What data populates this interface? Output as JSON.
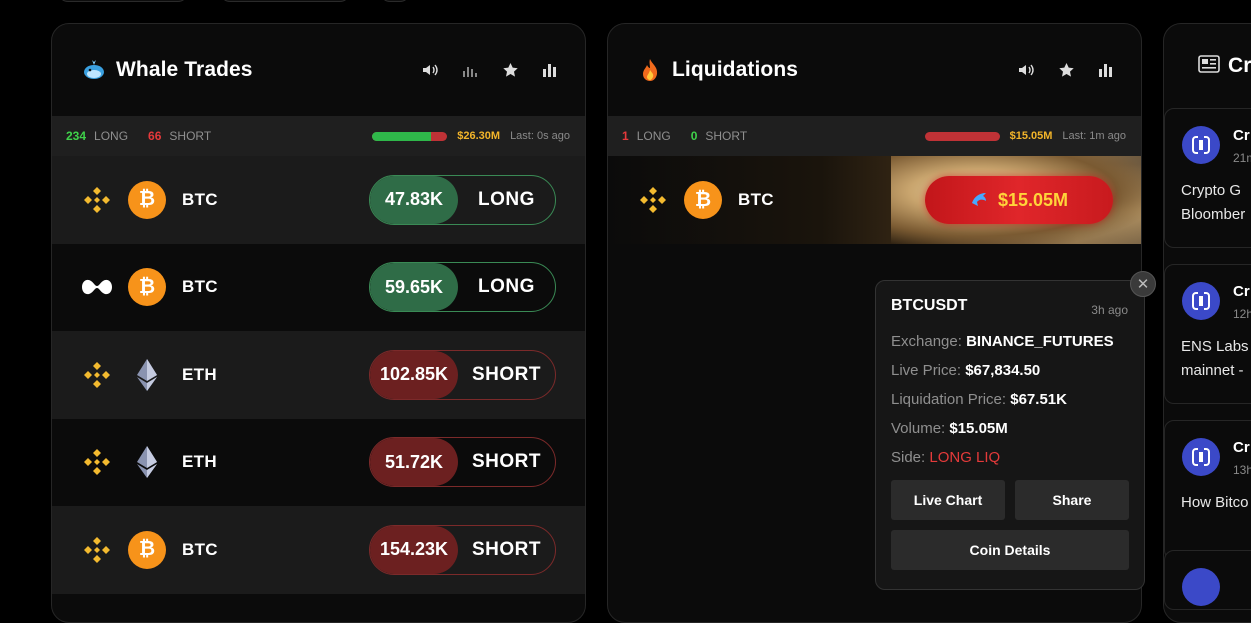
{
  "whale": {
    "title": "Whale Trades",
    "long_count": "234",
    "long_label": "LONG",
    "short_count": "66",
    "short_label": "SHORT",
    "long_ratio": 0.78,
    "total": "$26.30M",
    "last": "Last: 0s ago",
    "rows": [
      {
        "exchange": "binance-icon",
        "coin": "BTC",
        "value": "47.83K",
        "side": "LONG"
      },
      {
        "exchange": "hyperliquid-icon",
        "coin": "BTC",
        "value": "59.65K",
        "side": "LONG"
      },
      {
        "exchange": "binance-icon",
        "coin": "ETH",
        "value": "102.85K",
        "side": "SHORT"
      },
      {
        "exchange": "binance-icon",
        "coin": "ETH",
        "value": "51.72K",
        "side": "SHORT"
      },
      {
        "exchange": "binance-icon",
        "coin": "BTC",
        "value": "154.23K",
        "side": "SHORT"
      }
    ]
  },
  "liq": {
    "title": "Liquidations",
    "long_count": "1",
    "long_label": "LONG",
    "short_count": "0",
    "short_label": "SHORT",
    "long_ratio": 1.0,
    "total": "$15.05M",
    "last": "Last: 1m ago",
    "row": {
      "coin": "BTC",
      "amount": "$15.05M"
    }
  },
  "tooltip": {
    "symbol": "BTCUSDT",
    "time": "3h ago",
    "exchange_label": "Exchange:",
    "exchange": "BINANCE_FUTURES",
    "live_label": "Live Price:",
    "live": "$67,834.50",
    "liq_label": "Liquidation Price:",
    "liq": "$67.51K",
    "volume_label": "Volume:",
    "volume": "$15.05M",
    "side_label": "Side:",
    "side": "LONG LIQ",
    "btn_chart": "Live Chart",
    "btn_share": "Share",
    "btn_details": "Coin Details"
  },
  "news": {
    "title": "Cr",
    "cards": [
      {
        "author": "Cr",
        "time": "21m",
        "text1": "Crypto G",
        "text2": "Bloomber"
      },
      {
        "author": "Cr",
        "time": "12h",
        "text1": "ENS Labs",
        "text2": "mainnet -"
      },
      {
        "author": "Cr",
        "time": "13h",
        "text1": "How Bitco",
        "text2": ""
      }
    ]
  },
  "colors": {
    "long": "#3fd14a",
    "short": "#e6393b",
    "accent": "#f3b52a"
  }
}
